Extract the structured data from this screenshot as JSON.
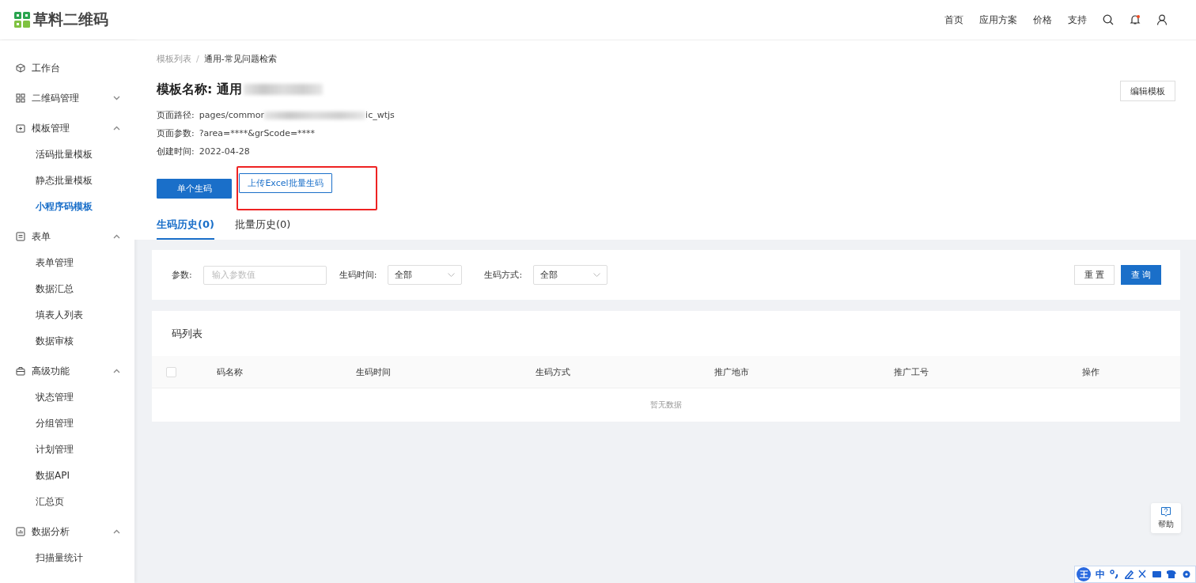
{
  "header": {
    "logo_text": "草料二维码",
    "nav": [
      "首页",
      "应用方案",
      "价格",
      "支持"
    ],
    "has_notification": true
  },
  "sidebar": {
    "groups": [
      {
        "label": "工作台"
      },
      {
        "label": "二维码管理",
        "expanded": false
      },
      {
        "label": "模板管理",
        "expanded": true,
        "children": [
          {
            "label": "活码批量模板",
            "selected": false
          },
          {
            "label": "静态批量模板",
            "selected": false
          },
          {
            "label": "小程序码模板",
            "selected": true
          }
        ]
      },
      {
        "label": "表单",
        "expanded": true,
        "children": [
          {
            "label": "表单管理",
            "selected": false
          },
          {
            "label": "数据汇总",
            "selected": false
          },
          {
            "label": "填表人列表",
            "selected": false
          },
          {
            "label": "数据审核",
            "selected": false
          }
        ]
      },
      {
        "label": "高级功能",
        "expanded": true,
        "children": [
          {
            "label": "状态管理",
            "selected": false
          },
          {
            "label": "分组管理",
            "selected": false
          },
          {
            "label": "计划管理",
            "selected": false
          },
          {
            "label": "数据API",
            "selected": false
          },
          {
            "label": "汇总页",
            "selected": false
          }
        ]
      },
      {
        "label": "数据分析",
        "expanded": true,
        "children": [
          {
            "label": "扫描量统计",
            "selected": false
          }
        ]
      }
    ]
  },
  "breadcrumb": [
    "模板列表",
    "/",
    "通用-常见问题检索"
  ],
  "template": {
    "title": "模板名称: 通用",
    "edit_button": "编辑模板",
    "meta": [
      {
        "label": "页面路径:",
        "value": "pages/commor",
        "value_end": "ic_wtjs",
        "blurred": true
      },
      {
        "label": "页面参数:",
        "value": "?area=****&grScode=****"
      },
      {
        "label": "创建时间:",
        "value": "2022-04-28"
      }
    ],
    "buttons": [
      {
        "label": "单个生码",
        "kind": "primary",
        "highlighted": false
      },
      {
        "label": "上传Excel批量生码",
        "kind": "outline",
        "highlighted": true
      }
    ]
  },
  "tabs": [
    {
      "label": "生码历史(0)",
      "selected": true
    },
    {
      "label": "批量历史(0)",
      "selected": false
    }
  ],
  "filters": {
    "param_label": "参数:",
    "param_placeholder": "输入参数值",
    "time_label": "生码时间:",
    "time_value": "全部",
    "method_label": "生码方式:",
    "method_value": "全部",
    "reset": "重 置",
    "query": "查 询"
  },
  "table": {
    "title": "码列表",
    "all_checked": false,
    "columns": [
      "码名称",
      "生码时间",
      "生码方式",
      "推广地市",
      "推广工号",
      "操作"
    ],
    "empty": "暂无数据"
  },
  "help": {
    "label": "帮助"
  },
  "ime_toolbar": {
    "logo": "王",
    "mode": "中"
  }
}
